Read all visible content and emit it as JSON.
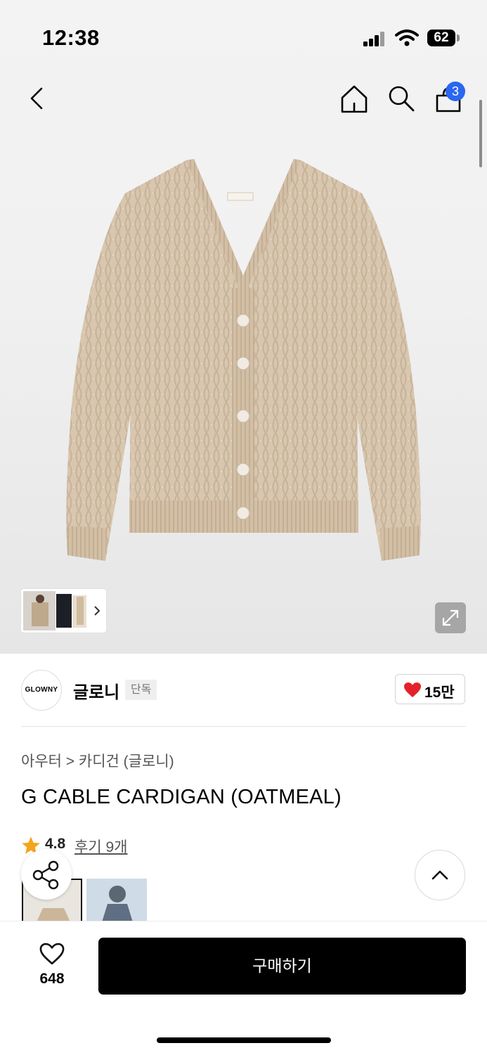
{
  "status_bar": {
    "time": "12:38",
    "battery": "62"
  },
  "nav": {
    "cart_count": "3"
  },
  "brand": {
    "logo_text": "GLOWNY",
    "name": "글로니",
    "badge": "단독",
    "like_count": "15만"
  },
  "product": {
    "breadcrumb": "아우터 > 카디건 (글로니)",
    "title": "G CABLE CARDIGAN (OATMEAL)",
    "rating": "4.8",
    "review_link": "후기 9개"
  },
  "bottom_bar": {
    "wish_count": "648",
    "buy_label": "구매하기"
  },
  "colors": {
    "cardigan": "#d8c6ae",
    "cart_badge": "#2a67f0",
    "heart": "#e4212b",
    "star": "#f4a51c",
    "buy_button": "#000000"
  },
  "icons": [
    "back-icon",
    "home-icon",
    "search-icon",
    "shopping-bag-icon",
    "expand-icon",
    "heart-icon",
    "star-icon",
    "share-icon",
    "chevron-up-icon",
    "heart-outline-icon"
  ]
}
